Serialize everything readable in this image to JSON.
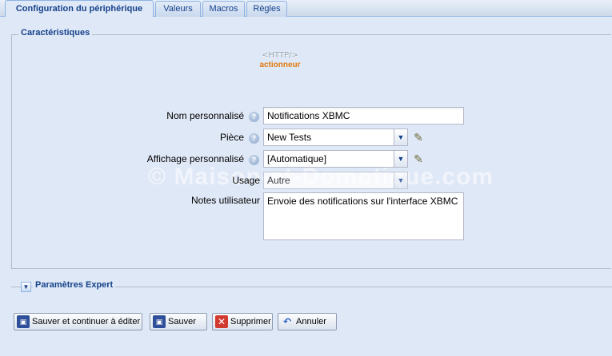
{
  "tabs": [
    {
      "label": "Configuration du périphérique",
      "active": true
    },
    {
      "label": "Valeurs",
      "active": false
    },
    {
      "label": "Macros",
      "active": false
    },
    {
      "label": "Règles",
      "active": false
    }
  ],
  "characteristics": {
    "legend": "Caractéristiques",
    "logo_text": "<HTTP/>",
    "logo_subtitle": "actionneur",
    "fields": {
      "name": {
        "label": "Nom personnalisé",
        "value": "Notifications XBMC"
      },
      "room": {
        "label": "Pièce",
        "value": "New Tests"
      },
      "display": {
        "label": "Affichage personnalisé",
        "value": "[Automatique]"
      },
      "usage": {
        "label": "Usage",
        "value": "Autre"
      },
      "notes": {
        "label": "Notes utilisateur",
        "value": "Envoie des notifications sur l'interface XBMC"
      }
    },
    "watermark": "© Maison-et-Domotique.com"
  },
  "expert": {
    "label": "Paramètres Expert"
  },
  "buttons": {
    "save_continue": "Sauver et continuer à éditer",
    "save": "Sauver",
    "delete": "Supprimer",
    "cancel": "Annuler"
  },
  "colors": {
    "panel_bg": "#dfe8f6",
    "header_text": "#15428b",
    "logo_accent": "#e07a10"
  },
  "icons": {
    "help": "help-icon",
    "edit": "pencil-icon",
    "save": "floppy-disk-icon",
    "delete": "delete-icon",
    "cancel": "undo-icon",
    "expand": "chevron-down-icon"
  }
}
